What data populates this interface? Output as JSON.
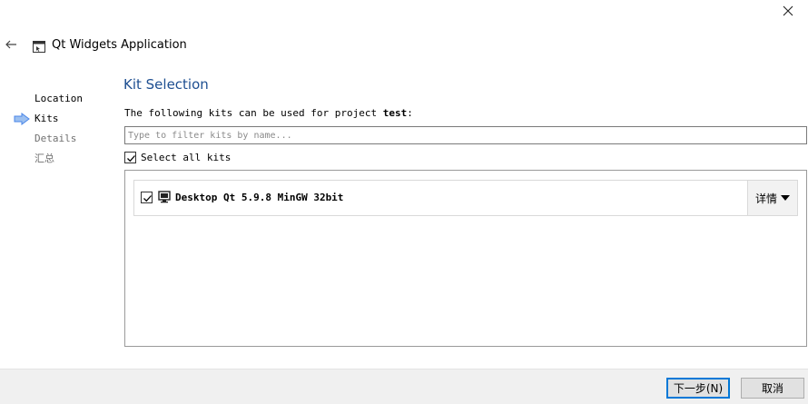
{
  "window": {
    "close_icon": "close-icon"
  },
  "header": {
    "back_icon": "back-arrow-icon",
    "app_icon": "qt-widgets-app-icon",
    "title": "Qt Widgets Application"
  },
  "steps": [
    {
      "label": "Location",
      "state": "done"
    },
    {
      "label": "Kits",
      "state": "current"
    },
    {
      "label": "Details",
      "state": "pending"
    },
    {
      "label": "汇总",
      "state": "pending"
    }
  ],
  "colors": {
    "title_blue": "#1e4f91",
    "step_arrow": "#4a86e8",
    "default_button_border": "#0078d7"
  },
  "main": {
    "title": "Kit Selection",
    "intro_prefix": "The following kits can be used for project ",
    "project_name": "test",
    "intro_suffix": ":",
    "filter_placeholder": "Type to filter kits by name...",
    "filter_value": "",
    "select_all_label": "Select all kits",
    "select_all_checked": true,
    "kits": [
      {
        "name": "Desktop Qt 5.9.8 MinGW 32bit",
        "checked": true,
        "icon": "monitor-icon",
        "details_label": "详情"
      }
    ]
  },
  "footer": {
    "next_label": "下一步(N)",
    "cancel_label": "取消"
  }
}
